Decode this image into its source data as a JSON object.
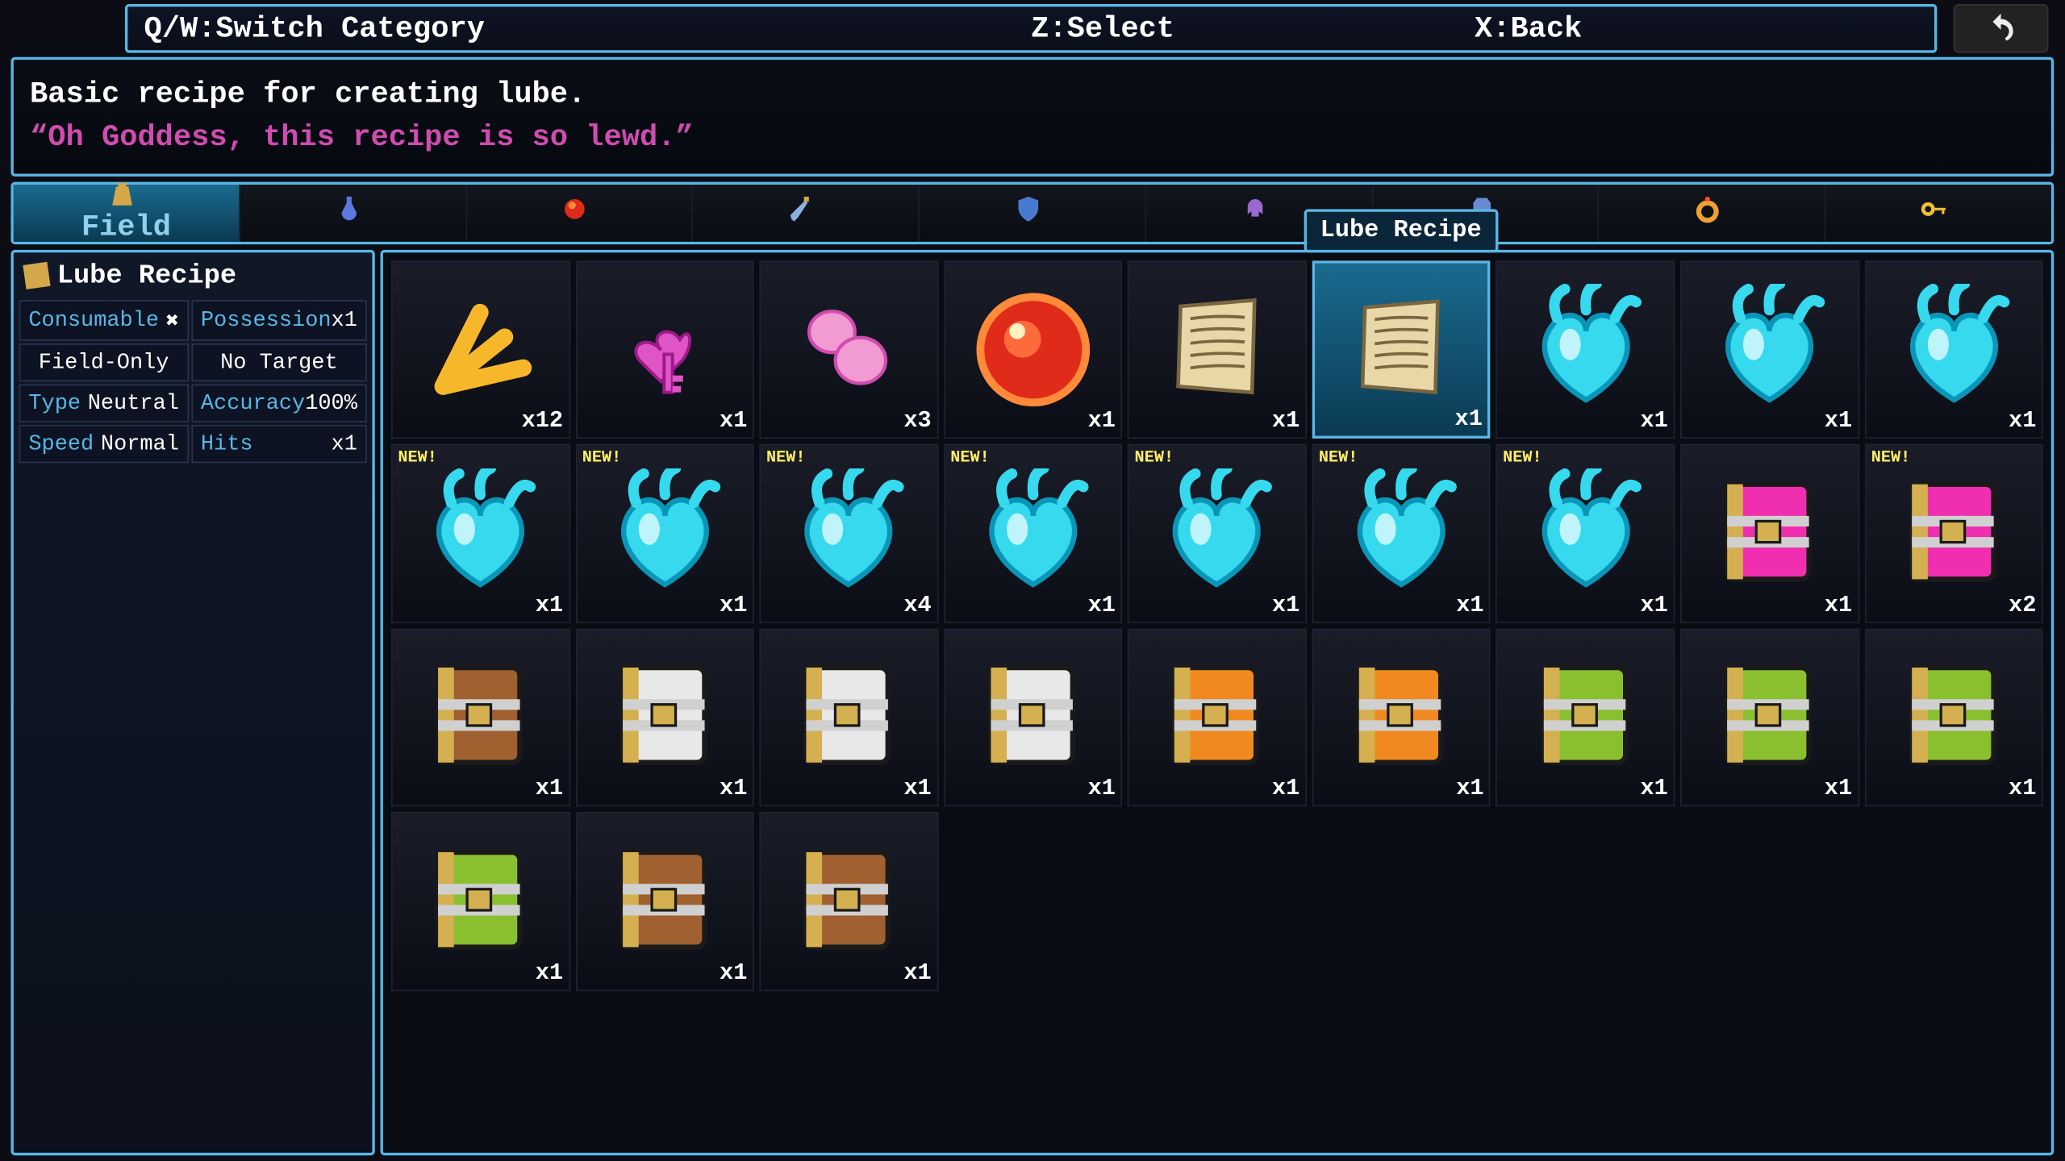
{
  "help_bar": {
    "switch": "Q/W:Switch Category",
    "select": "Z:Select",
    "back": "X:Back"
  },
  "description": {
    "line1": "Basic recipe for creating lube.",
    "line2": "“Oh Goddess, this recipe is so lewd.”"
  },
  "tooltip": "Lube Recipe",
  "selected_item": "Lube Recipe",
  "categories": [
    {
      "id": "field",
      "label": "Field",
      "icon": "bag-icon",
      "active": true
    },
    {
      "id": "potion",
      "label": "",
      "icon": "potion-icon",
      "active": false
    },
    {
      "id": "orb",
      "label": "",
      "icon": "red-orb-icon",
      "active": false
    },
    {
      "id": "weapon",
      "label": "",
      "icon": "sword-icon",
      "active": false
    },
    {
      "id": "shield",
      "label": "",
      "icon": "shield-icon",
      "active": false
    },
    {
      "id": "armor1",
      "label": "",
      "icon": "helm-icon",
      "active": false
    },
    {
      "id": "armor2",
      "label": "",
      "icon": "armor-icon",
      "active": false
    },
    {
      "id": "ring",
      "label": "",
      "icon": "ring-icon",
      "active": false
    },
    {
      "id": "key",
      "label": "",
      "icon": "key-icon",
      "active": false
    }
  ],
  "details": {
    "title": "Lube Recipe",
    "stats": [
      {
        "label": "Consumable",
        "value": "✖",
        "half": true
      },
      {
        "label": "Possession",
        "value": "x1",
        "half": true
      },
      {
        "label": "",
        "value": "Field-Only",
        "half": true,
        "center": true
      },
      {
        "label": "",
        "value": "No Target",
        "half": true,
        "center": true
      },
      {
        "label": "Type",
        "value": "Neutral",
        "half": true
      },
      {
        "label": "Accuracy",
        "value": "100%",
        "half": true
      },
      {
        "label": "Speed",
        "value": "Normal",
        "half": true
      },
      {
        "label": "Hits",
        "value": "x1",
        "half": true
      }
    ]
  },
  "items": [
    {
      "icon": "twig",
      "qty": "x12",
      "new": false
    },
    {
      "icon": "heartkey",
      "qty": "x1",
      "new": false
    },
    {
      "icon": "jellies",
      "qty": "x3",
      "new": false
    },
    {
      "icon": "orb",
      "qty": "x1",
      "new": false
    },
    {
      "icon": "recipe-tan",
      "qty": "x1",
      "new": false
    },
    {
      "icon": "recipe-tan",
      "qty": "x1",
      "new": false,
      "selected": true
    },
    {
      "icon": "soul",
      "qty": "x1",
      "new": false
    },
    {
      "icon": "soul",
      "qty": "x1",
      "new": false
    },
    {
      "icon": "soul",
      "qty": "x1",
      "new": false
    },
    {
      "icon": "soul",
      "qty": "x1",
      "new": true
    },
    {
      "icon": "soul",
      "qty": "x1",
      "new": true
    },
    {
      "icon": "soul",
      "qty": "x4",
      "new": true
    },
    {
      "icon": "soul",
      "qty": "x1",
      "new": true
    },
    {
      "icon": "soul",
      "qty": "x1",
      "new": true
    },
    {
      "icon": "soul",
      "qty": "x1",
      "new": true
    },
    {
      "icon": "soul",
      "qty": "x1",
      "new": true
    },
    {
      "icon": "book-pink",
      "qty": "x1",
      "new": false
    },
    {
      "icon": "book-pink",
      "qty": "x2",
      "new": true
    },
    {
      "icon": "book-brown",
      "qty": "x1",
      "new": false
    },
    {
      "icon": "book-white",
      "qty": "x1",
      "new": false
    },
    {
      "icon": "book-white",
      "qty": "x1",
      "new": false
    },
    {
      "icon": "book-white",
      "qty": "x1",
      "new": false
    },
    {
      "icon": "book-orange",
      "qty": "x1",
      "new": false
    },
    {
      "icon": "book-orange",
      "qty": "x1",
      "new": false
    },
    {
      "icon": "book-green",
      "qty": "x1",
      "new": false
    },
    {
      "icon": "book-green",
      "qty": "x1",
      "new": false
    },
    {
      "icon": "book-green",
      "qty": "x1",
      "new": false
    },
    {
      "icon": "book-green",
      "qty": "x1",
      "new": false
    },
    {
      "icon": "book-brown",
      "qty": "x1",
      "new": false
    },
    {
      "icon": "book-brown",
      "qty": "x1",
      "new": false
    }
  ],
  "new_label": "NEW!",
  "colors": {
    "border": "#5ab6e6",
    "quote": "#d04cb0",
    "stat_label": "#5ab6e6"
  }
}
